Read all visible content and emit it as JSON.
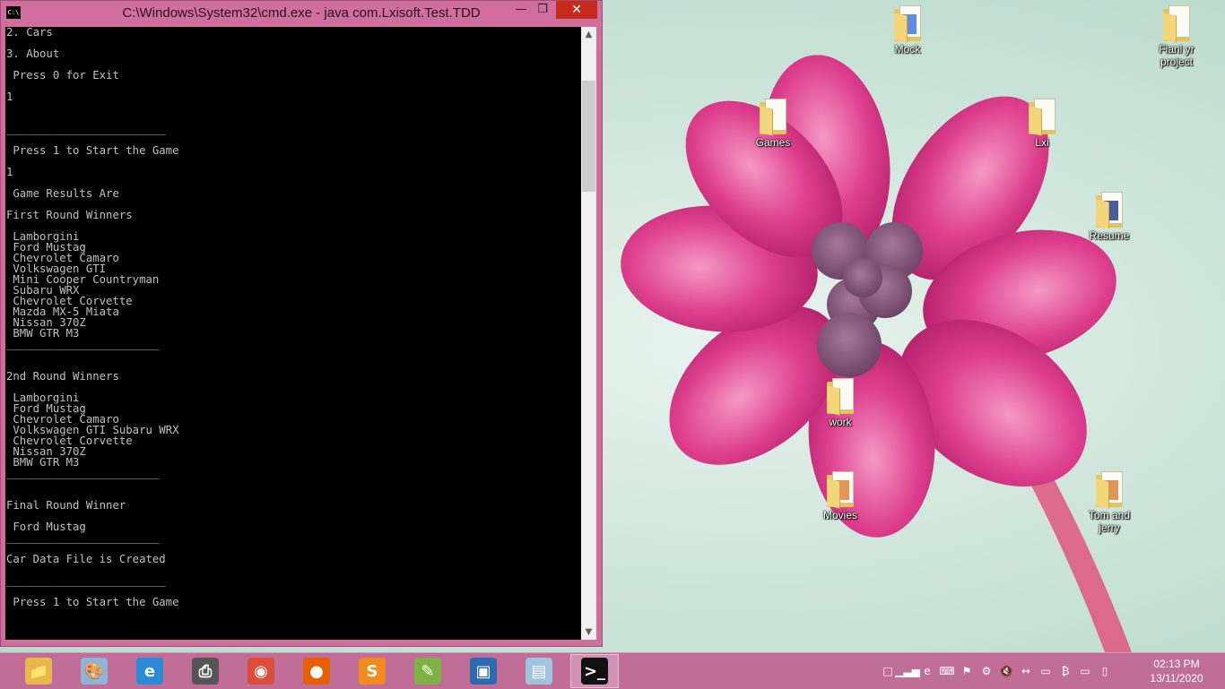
{
  "cmd": {
    "title": "C:\\Windows\\System32\\cmd.exe - java  com.Lxisoft.Test.TDD",
    "icon_text": "C:\\",
    "lines": [
      "2. Cars",
      "",
      "3. About",
      "",
      " Press 0 for Exit",
      "",
      "1",
      "",
      "",
      "________________________",
      "",
      " Press 1 to Start the Game",
      "",
      "1",
      "",
      " Game Results Are",
      "",
      "First Round Winners",
      "",
      " Lamborgini",
      " Ford Mustag",
      " Chevrolet Camaro",
      " Volkswagen GTI",
      " Mini Cooper Countryman",
      " Subaru WRX",
      " Chevrolet Corvette",
      " Mazda MX-5 Miata",
      " Nissan 370Z",
      " BMW GTR M3",
      "_______________________",
      "",
      "",
      "2nd Round Winners",
      "",
      " Lamborgini",
      " Ford Mustag",
      " Chevrolet Camaro",
      " Volkswagen GTI Subaru WRX",
      " Chevrolet Corvette",
      " Nissan 370Z",
      " BMW GTR M3",
      "_______________________",
      "",
      "",
      "Final Round Winner",
      "",
      " Ford Mustag",
      "_______________________",
      "",
      "Car Data File is Created",
      "",
      "________________________",
      "",
      " Press 1 to Start the Game"
    ]
  },
  "desktop_icons": [
    {
      "label": "Mock",
      "tint": "#3a6fd8"
    },
    {
      "label": "Fianl yr\nproject",
      "tint": "#e8e8e8"
    },
    {
      "label": "Games",
      "tint": "#d9b24a"
    },
    {
      "label": "Lxi",
      "tint": "#d9b24a"
    },
    {
      "label": "Resume",
      "tint": "#2c3f8c"
    },
    {
      "label": "work",
      "tint": "#efefef"
    },
    {
      "label": "Movies",
      "tint": "#e07a30"
    },
    {
      "label": "Tom and\njerry",
      "tint": "#e07a30"
    }
  ],
  "taskbar": {
    "apps": [
      {
        "name": "file-explorer-icon",
        "color": "#e8b84a"
      },
      {
        "name": "paint-icon",
        "color": "#8fb4d9"
      },
      {
        "name": "internet-explorer-icon",
        "color": "#2a8ad8"
      },
      {
        "name": "scanner-icon",
        "color": "#555555"
      },
      {
        "name": "chrome-icon",
        "color": "#dd4b39"
      },
      {
        "name": "firefox-icon",
        "color": "#e66000"
      },
      {
        "name": "sublime-text-icon",
        "color": "#f28a1d"
      },
      {
        "name": "notepad-plus-icon",
        "color": "#7cb342"
      },
      {
        "name": "virtualbox-icon",
        "color": "#2d6ab0"
      },
      {
        "name": "notes-icon",
        "color": "#9ec4e0"
      },
      {
        "name": "cmd-icon",
        "color": "#111111"
      }
    ],
    "tray": [
      "action-center-icon",
      "signal-icon",
      "language-icon",
      "keyboard-icon",
      "flag-icon",
      "settings-icon",
      "volume-mute-icon",
      "network-icon",
      "display-icon",
      "bitcoin-icon",
      "monitor-icon",
      "battery-icon"
    ],
    "clock_time": "02:13 PM",
    "clock_date": "13/11/2020"
  },
  "colors": {
    "console_bg": "#000000",
    "console_fg": "#c0c0c0",
    "window_frame": "#d06ea0",
    "taskbar": "#c06e98",
    "close_button": "#c42b1c"
  }
}
